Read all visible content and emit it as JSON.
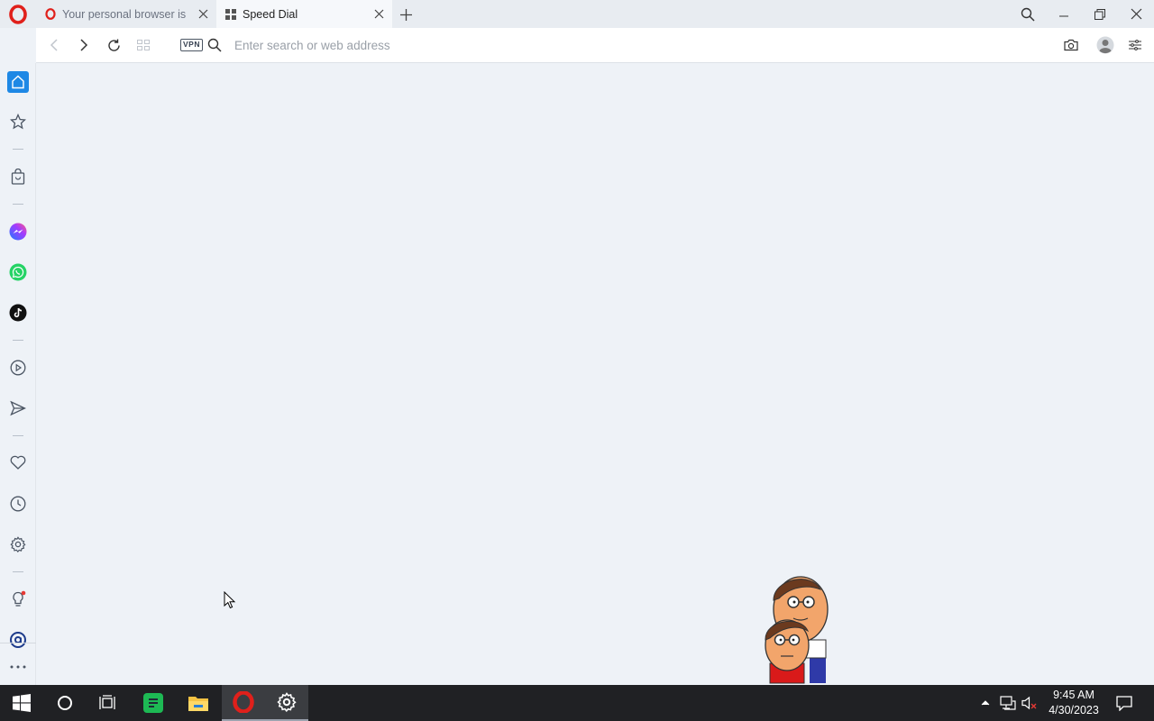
{
  "tabs": [
    {
      "title": "Your personal browser is",
      "active": false
    },
    {
      "title": "Speed Dial",
      "active": true
    }
  ],
  "addressbar": {
    "placeholder": "Enter search or web address",
    "vpn_label": "VPN"
  },
  "sidebar": {
    "items": [
      "home-icon",
      "bookmarks-icon",
      "shopping-icon",
      "messenger-icon",
      "whatsapp-icon",
      "tiktok-icon",
      "player-icon",
      "flow-icon",
      "pinboards-icon",
      "history-icon",
      "settings-icon",
      "tips-icon",
      "aria-icon",
      "more-icon"
    ]
  },
  "taskbar": {
    "apps": [
      "windows-start-icon",
      "cortana-search-icon",
      "task-view-icon",
      "spotify-icon",
      "file-explorer-icon",
      "opera-icon",
      "settings-icon"
    ],
    "clock_time": "9:45 AM",
    "clock_date": "4/30/2023"
  },
  "colors": {
    "opera_red": "#e0201b",
    "accent_blue": "#1e88e5"
  }
}
